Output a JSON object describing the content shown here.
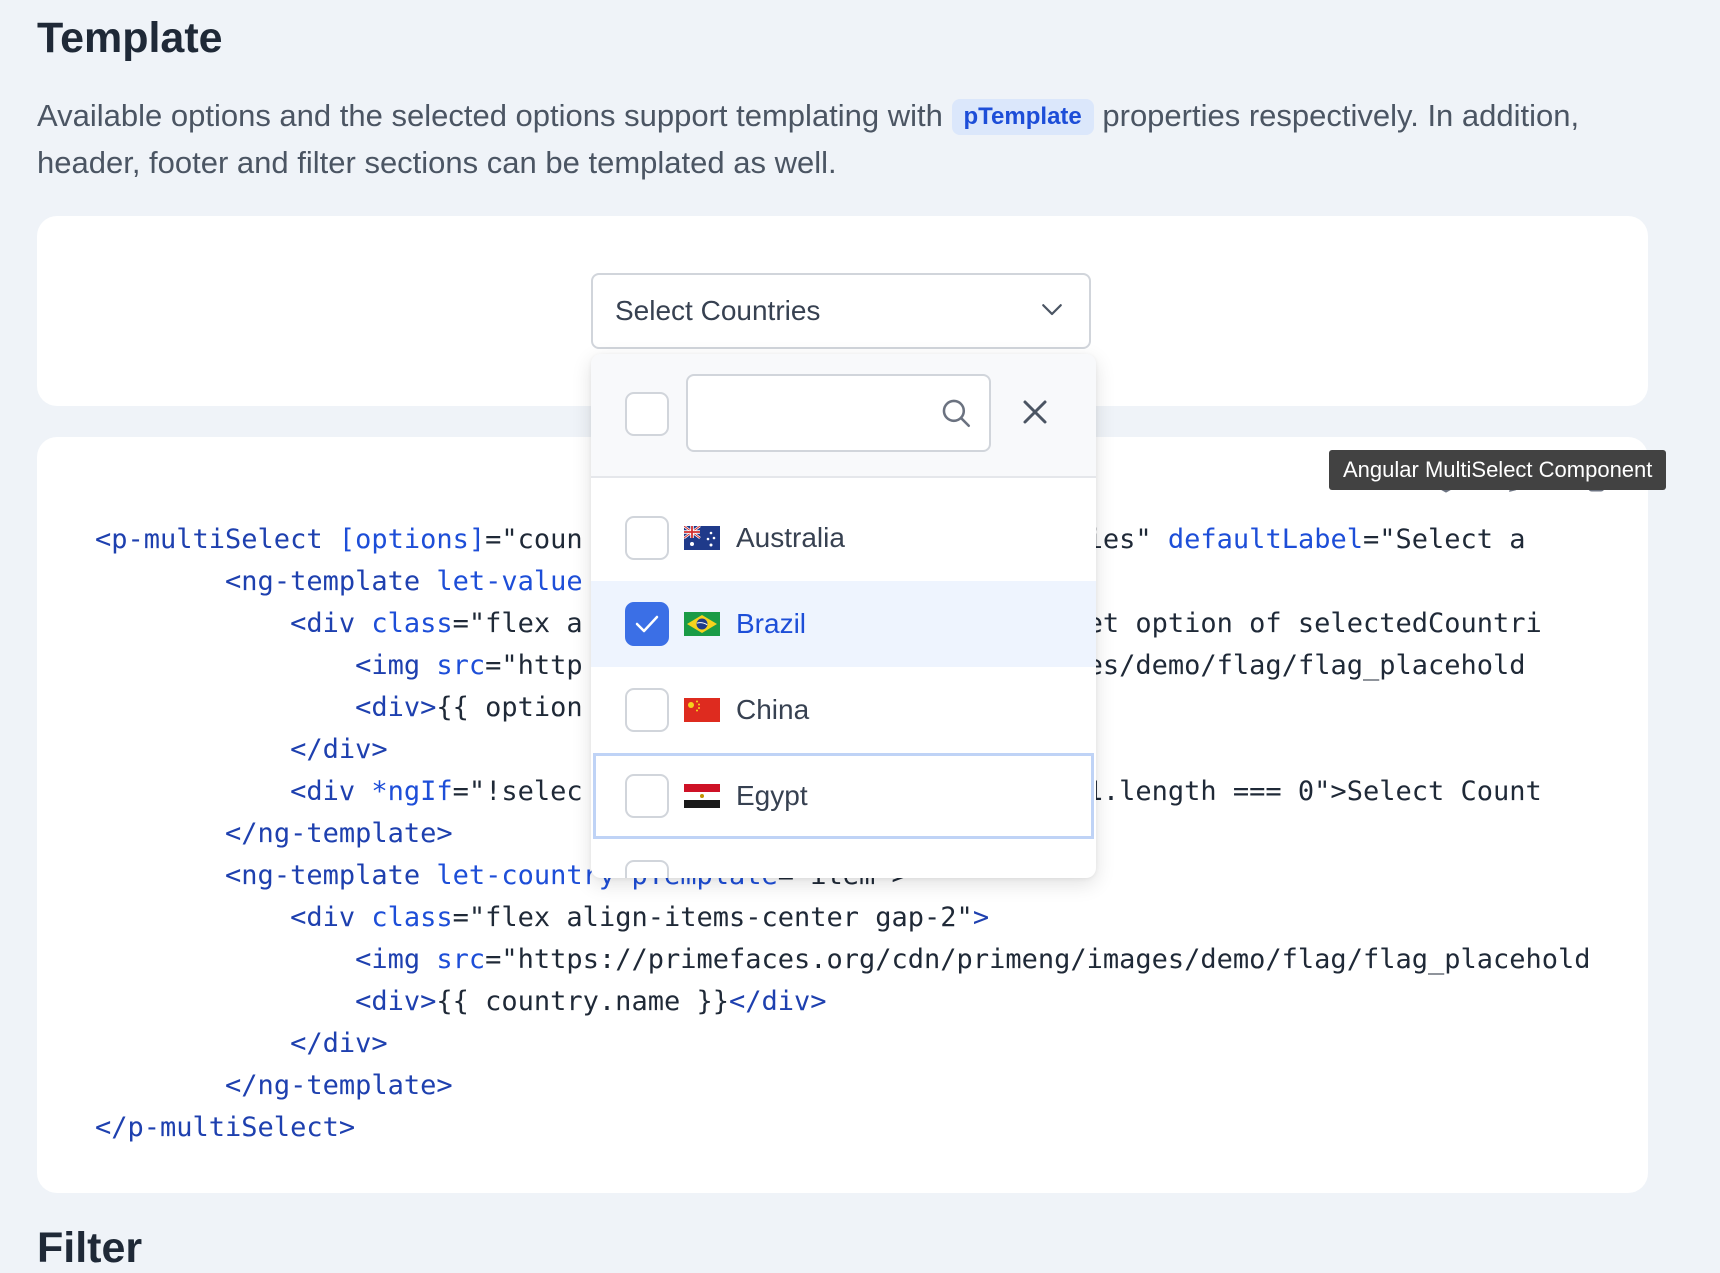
{
  "section": {
    "title": "Template",
    "intro_before": "Available options and the selected options support templating with ",
    "intro_code": "pTemplate",
    "intro_after": " properties respectively. In addition, header, footer and filter sections can be templated as well."
  },
  "multiselect": {
    "placeholder": "Select Countries",
    "filter_value": "",
    "options": [
      {
        "name": "Australia",
        "checked": false,
        "flag": "australia-flag"
      },
      {
        "name": "Brazil",
        "checked": true,
        "flag": "brazil-flag"
      },
      {
        "name": "China",
        "checked": false,
        "flag": "china-flag"
      },
      {
        "name": "Egypt",
        "checked": false,
        "flag": "egypt-flag"
      }
    ]
  },
  "tooltip": "Angular MultiSelect Component",
  "code_lines": [
    [
      [
        "t",
        "<p-multiSelect "
      ],
      [
        "a",
        "[options]"
      ],
      [
        "s",
        "=\"coun"
      ],
      [
        "s",
        "                          "
      ],
      [
        "s",
        "ountries\" "
      ],
      [
        "a",
        "defaultLabel"
      ],
      [
        "s",
        "=\"Select a"
      ]
    ],
    [
      [
        "s",
        "        "
      ],
      [
        "t",
        "<ng-template "
      ],
      [
        "a",
        "let-value"
      ]
    ],
    [
      [
        "s",
        "            "
      ],
      [
        "t",
        "<div "
      ],
      [
        "a",
        "class"
      ],
      [
        "s",
        "=\"flex a"
      ],
      [
        "s",
        "                          "
      ],
      [
        "s",
        "or=\"let option of selectedCountri"
      ]
    ],
    [
      [
        "s",
        "                "
      ],
      [
        "t",
        "<img "
      ],
      [
        "a",
        "src"
      ],
      [
        "s",
        "=\"http"
      ],
      [
        "s",
        "                         "
      ],
      [
        "s",
        "g/images/demo/flag/flag_placehold"
      ]
    ],
    [
      [
        "s",
        "                "
      ],
      [
        "t",
        "<div>"
      ],
      [
        "x",
        "{{ option"
      ]
    ],
    [
      [
        "s",
        "            "
      ],
      [
        "t",
        "</div>"
      ]
    ],
    [
      [
        "s",
        "            "
      ],
      [
        "t",
        "<div "
      ],
      [
        "a",
        "*ngIf"
      ],
      [
        "s",
        "=\"!selec"
      ],
      [
        "s",
        "                          "
      ],
      [
        "s",
        "tries1.length === 0\">"
      ],
      [
        "x",
        "Select Count"
      ]
    ],
    [
      [
        "s",
        "        "
      ],
      [
        "t",
        "</ng-template>"
      ]
    ],
    [
      [
        "s",
        "        "
      ],
      [
        "t",
        "<ng-template "
      ],
      [
        "a",
        "let-country pTemplate"
      ],
      [
        "s",
        "=\"item\">"
      ]
    ],
    [
      [
        "s",
        "            "
      ],
      [
        "t",
        "<div "
      ],
      [
        "a",
        "class"
      ],
      [
        "s",
        "=\"flex align-items-center gap-2\""
      ],
      [
        "t",
        ">"
      ]
    ],
    [
      [
        "s",
        "                "
      ],
      [
        "t",
        "<img "
      ],
      [
        "a",
        "src"
      ],
      [
        "s",
        "=\"https://primefaces.org/cdn/primeng/images/demo/flag/flag_placehold"
      ]
    ],
    [
      [
        "s",
        "                "
      ],
      [
        "t",
        "<div>"
      ],
      [
        "x",
        "{{ country.name }}"
      ],
      [
        "t",
        "</div>"
      ]
    ],
    [
      [
        "s",
        "            "
      ],
      [
        "t",
        "</div>"
      ]
    ],
    [
      [
        "s",
        "        "
      ],
      [
        "t",
        "</ng-template>"
      ]
    ],
    [
      [
        "t",
        "</p-multiSelect>"
      ]
    ]
  ],
  "next_section": {
    "title": "Filter"
  }
}
